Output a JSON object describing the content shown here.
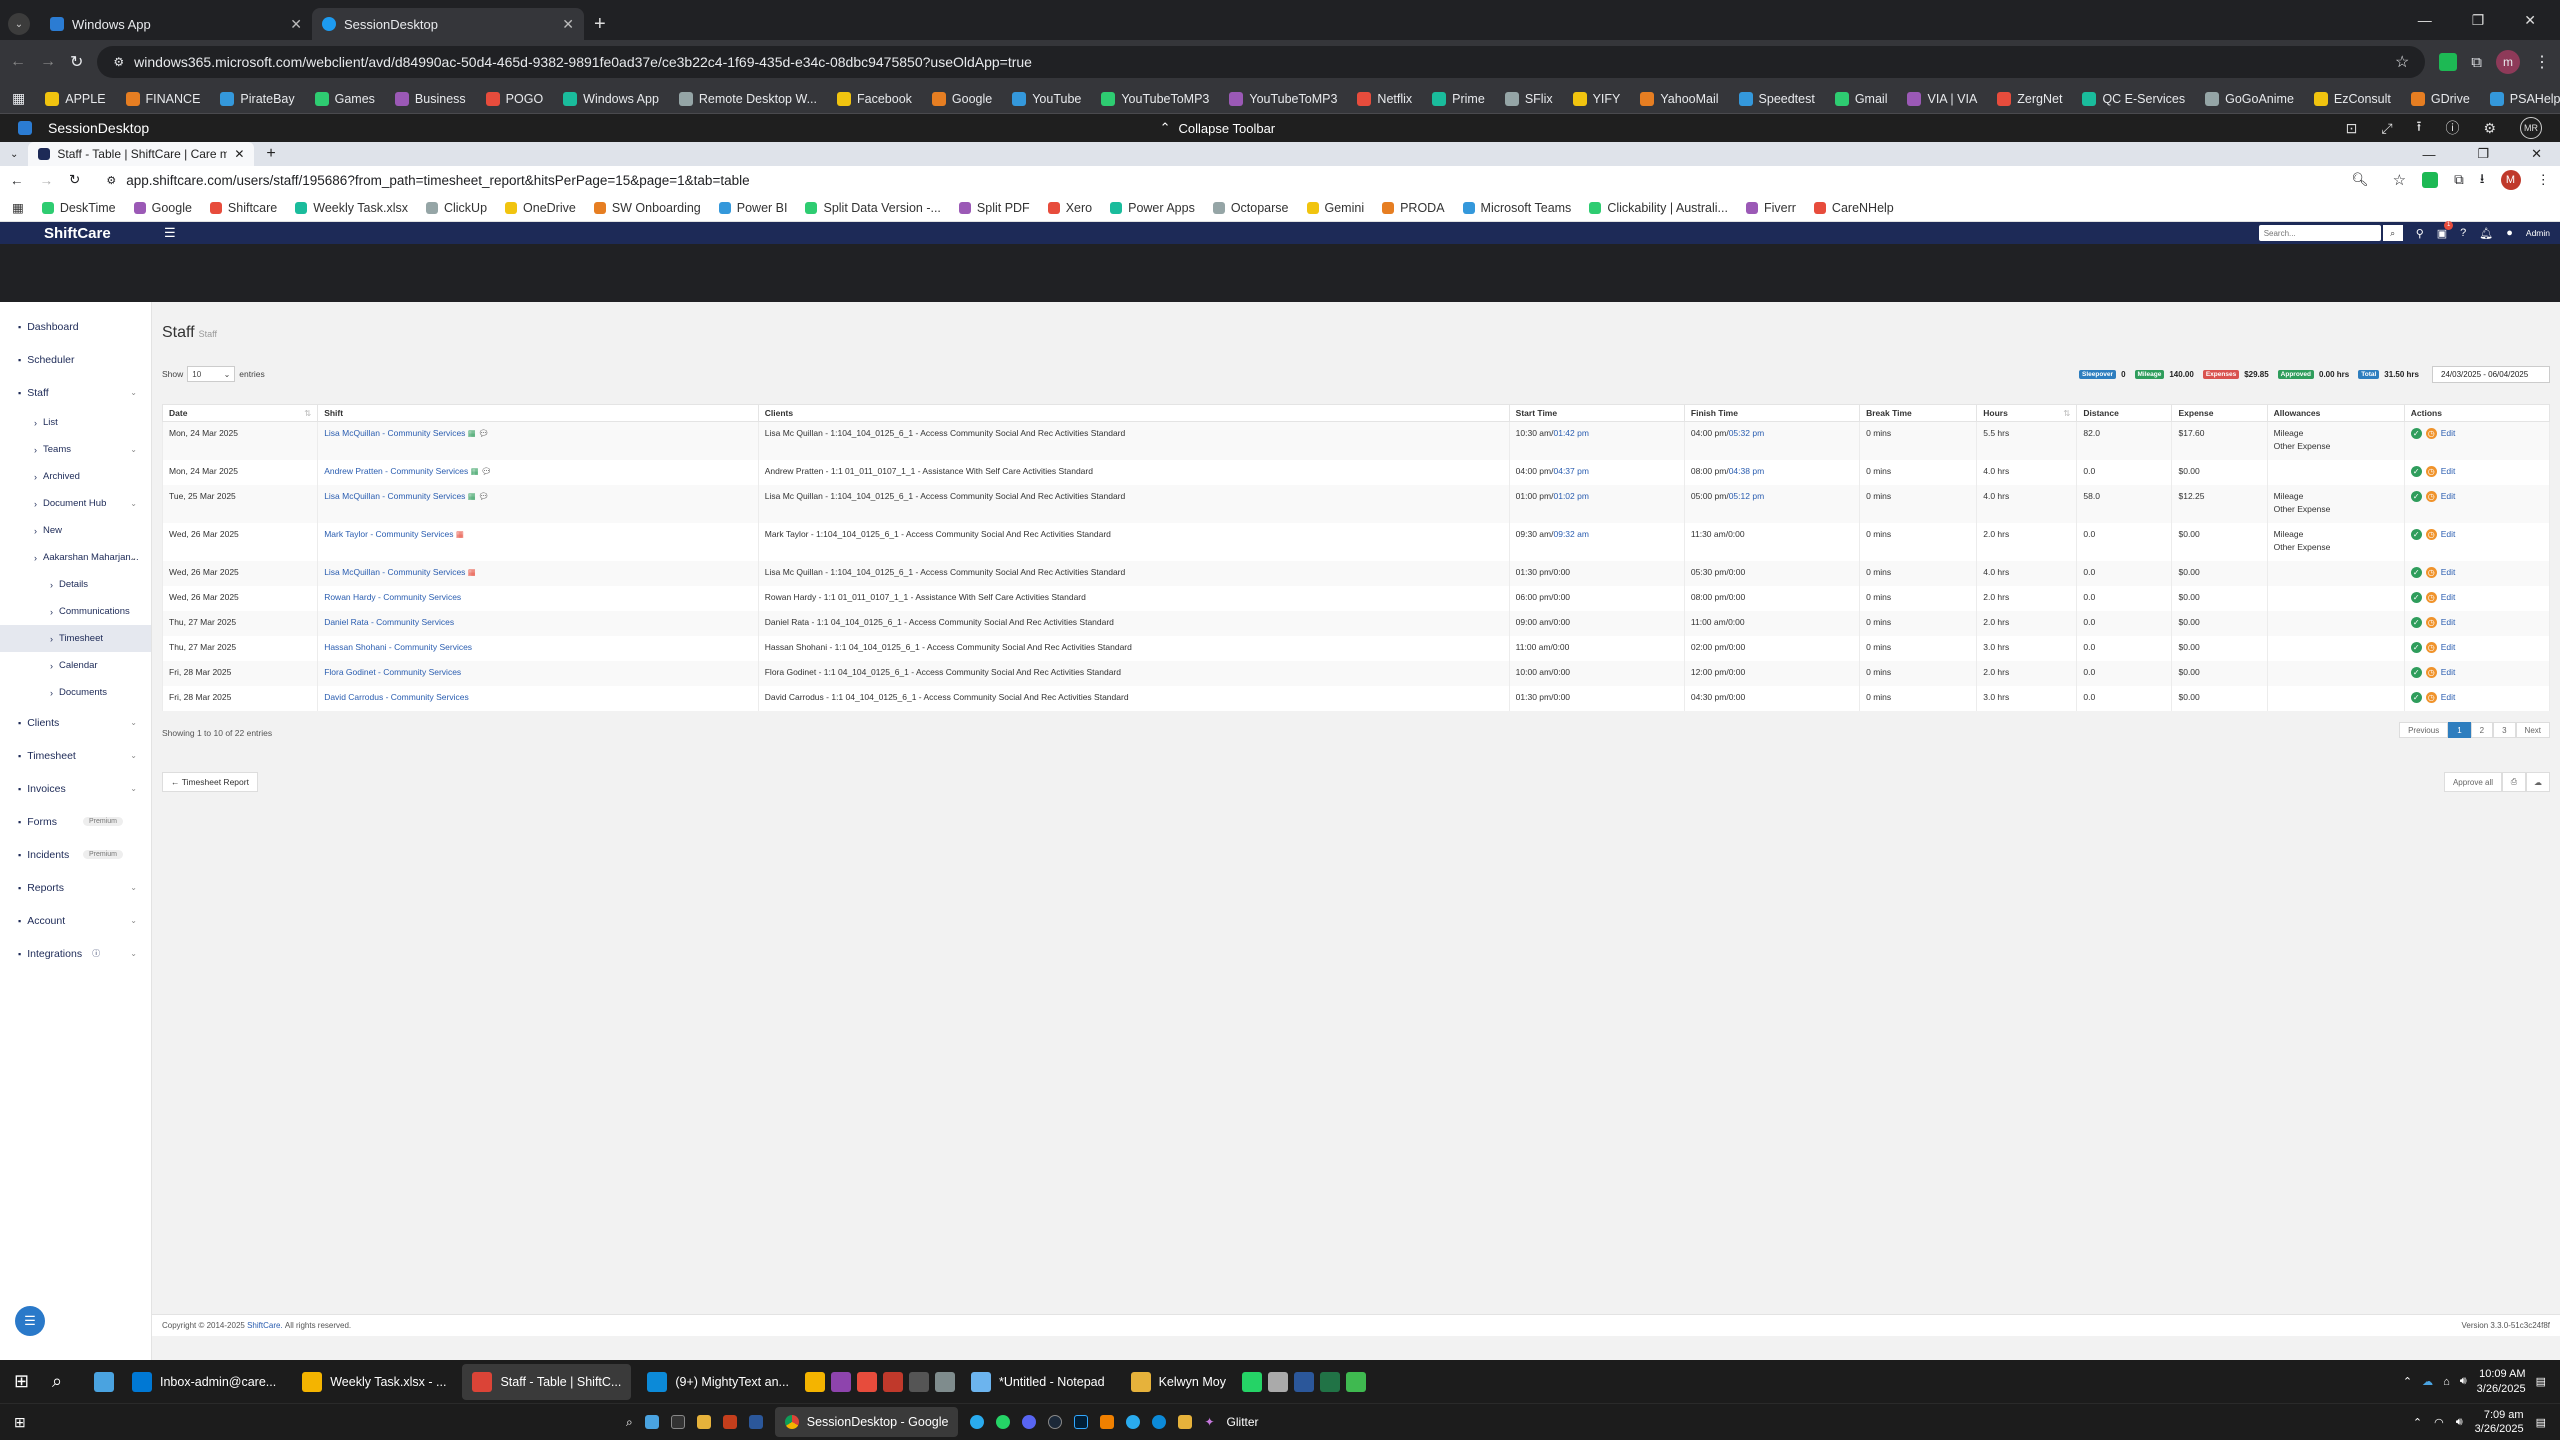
{
  "outer_browser": {
    "tabs": [
      {
        "title": "Windows App"
      },
      {
        "title": "SessionDesktop"
      }
    ],
    "url": "windows365.microsoft.com/webclient/avd/d84990ac-50d4-465d-9382-9891fe0ad37e/ce3b22c4-1f69-435d-e34c-08dbc9475850?useOldApp=true",
    "bookmarks": [
      "APPLE",
      "FINANCE",
      "PirateBay",
      "Games",
      "Business",
      "POGO",
      "Windows App",
      "Remote Desktop W...",
      "Facebook",
      "Google",
      "YouTube",
      "YouTubeToMP3",
      "YouTubeToMP3",
      "Netflix",
      "Prime",
      "SFlix",
      "YIFY",
      "YahooMail",
      "Speedtest",
      "Gmail",
      "VIA | VIA",
      "ZergNet",
      "QC E-Services",
      "GoGoAnime",
      "EzConsult",
      "GDrive",
      "PSAHelpLine"
    ],
    "profile": "m"
  },
  "session": {
    "title": "SessionDesktop",
    "collapse_label": "Collapse Toolbar",
    "avatar": "MR"
  },
  "inner_browser": {
    "tab_title": "Staff - Table | ShiftCare | Care m",
    "url": "app.shiftcare.com/users/staff/195686?from_path=timesheet_report&hitsPerPage=15&page=1&tab=table",
    "profile": "M",
    "bookmarks": [
      "DeskTime",
      "Google",
      "Shiftcare",
      "Weekly Task.xlsx",
      "ClickUp",
      "OneDrive",
      "SW Onboarding",
      "Power BI",
      "Split Data Version -...",
      "Split PDF",
      "Xero",
      "Power Apps",
      "Octoparse",
      "Gemini",
      "PRODA",
      "Microsoft Teams",
      "Clickability | Australi...",
      "Fiverr",
      "CareNHelp"
    ]
  },
  "shiftcare": {
    "brand": "ShiftCare",
    "search_placeholder": "Search...",
    "notif_count": "1",
    "admin_label": "Admin",
    "sidebar": [
      {
        "label": "Dashboard",
        "level": 0,
        "icon": "dashboard-icon"
      },
      {
        "label": "Scheduler",
        "level": 0,
        "icon": "calendar-icon"
      },
      {
        "label": "Staff",
        "level": 0,
        "icon": "user-icon",
        "caret": true
      },
      {
        "label": "List",
        "level": 1
      },
      {
        "label": "Teams",
        "level": 1,
        "caret": true
      },
      {
        "label": "Archived",
        "level": 1
      },
      {
        "label": "Document Hub",
        "level": 1,
        "caret": true
      },
      {
        "label": "New",
        "level": 1
      },
      {
        "label": "Aakarshan Maharjan...",
        "level": 1,
        "caret": true
      },
      {
        "label": "Details",
        "level": 2
      },
      {
        "label": "Communications",
        "level": 2
      },
      {
        "label": "Timesheet",
        "level": 2,
        "selected": true
      },
      {
        "label": "Calendar",
        "level": 2
      },
      {
        "label": "Documents",
        "level": 2
      },
      {
        "label": "Clients",
        "level": 0,
        "icon": "clients-icon",
        "caret": true
      },
      {
        "label": "Timesheet",
        "level": 0,
        "icon": "clock-icon",
        "caret": true
      },
      {
        "label": "Invoices",
        "level": 0,
        "icon": "invoice-icon",
        "caret": true
      },
      {
        "label": "Forms",
        "level": 0,
        "icon": "forms-icon",
        "badge": "Premium"
      },
      {
        "label": "Incidents",
        "level": 0,
        "icon": "incident-icon",
        "badge": "Premium"
      },
      {
        "label": "Reports",
        "level": 0,
        "icon": "reports-icon",
        "caret": true
      },
      {
        "label": "Account",
        "level": 0,
        "icon": "account-icon",
        "caret": true
      },
      {
        "label": "Integrations",
        "level": 0,
        "icon": "plug-icon",
        "caret": true,
        "info": true
      }
    ],
    "page_title": "Staff",
    "page_subtitle": "Staff",
    "show_label": "Show",
    "show_value": "10",
    "entries_label": "entries",
    "summary": [
      {
        "label": "Sleepover",
        "value": "0",
        "color": "#2e7ebf"
      },
      {
        "label": "Mileage",
        "value": "140.00",
        "color": "#2f9d5c"
      },
      {
        "label": "Expenses",
        "value": "$29.85",
        "color": "#d9534f"
      },
      {
        "label": "Approved",
        "value": "0.00 hrs",
        "color": "#2f9d5c"
      },
      {
        "label": "Total",
        "value": "31.50 hrs",
        "color": "#2e7ebf"
      }
    ],
    "date_range": "24/03/2025 - 06/04/2025",
    "columns": [
      "Date",
      "Shift",
      "Clients",
      "Start Time",
      "Finish Time",
      "Break Time",
      "Hours",
      "Distance",
      "Expense",
      "Allowances",
      "Actions"
    ],
    "rows": [
      {
        "date": "Mon, 24 Mar 2025",
        "shift": "Lisa McQuillan - Community Services",
        "flag": "green",
        "chat": true,
        "client": "Lisa Mc Quillan - 1:104_104_0125_6_1 - Access Community Social And Rec Activities Standard",
        "start": "10:30 am/",
        "start2": "01:42 pm",
        "finish": "04:00 pm/",
        "finish2": "05:32 pm",
        "break": "0 mins",
        "hours": "5.5 hrs",
        "distance": "82.0",
        "expense": "$17.60",
        "allowances": [
          "Mileage",
          "Other Expense"
        ]
      },
      {
        "date": "Mon, 24 Mar 2025",
        "shift": "Andrew Pratten - Community Services",
        "flag": "green",
        "chat": true,
        "client": "Andrew Pratten - 1:1 01_011_0107_1_1 - Assistance With Self Care Activities Standard",
        "start": "04:00 pm/",
        "start2": "04:37 pm",
        "finish": "08:00 pm/",
        "finish2": "04:38 pm",
        "break": "0 mins",
        "hours": "4.0 hrs",
        "distance": "0.0",
        "expense": "$0.00",
        "allowances": []
      },
      {
        "date": "Tue, 25 Mar 2025",
        "shift": "Lisa McQuillan - Community Services",
        "flag": "green",
        "chat": true,
        "client": "Lisa Mc Quillan - 1:104_104_0125_6_1 - Access Community Social And Rec Activities Standard",
        "start": "01:00 pm/",
        "start2": "01:02 pm",
        "finish": "05:00 pm/",
        "finish2": "05:12 pm",
        "break": "0 mins",
        "hours": "4.0 hrs",
        "distance": "58.0",
        "expense": "$12.25",
        "allowances": [
          "Mileage",
          "Other Expense"
        ]
      },
      {
        "date": "Wed, 26 Mar 2025",
        "shift": "Mark Taylor - Community Services",
        "flag": "red",
        "chat": false,
        "client": "Mark Taylor - 1:104_104_0125_6_1 - Access Community Social And Rec Activities Standard",
        "start": "09:30 am/",
        "start2": "09:32 am",
        "finish": "11:30 am/",
        "finish2": "0:00",
        "break": "0 mins",
        "hours": "2.0 hrs",
        "distance": "0.0",
        "expense": "$0.00",
        "allowances": [
          "Mileage",
          "Other Expense"
        ]
      },
      {
        "date": "Wed, 26 Mar 2025",
        "shift": "Lisa McQuillan - Community Services",
        "flag": "red",
        "chat": false,
        "client": "Lisa Mc Quillan - 1:104_104_0125_6_1 - Access Community Social And Rec Activities Standard",
        "start": "01:30 pm/",
        "start2": "0:00",
        "finish": "05:30 pm/",
        "finish2": "0:00",
        "break": "0 mins",
        "hours": "4.0 hrs",
        "distance": "0.0",
        "expense": "$0.00",
        "allowances": []
      },
      {
        "date": "Wed, 26 Mar 2025",
        "shift": "Rowan Hardy - Community Services",
        "flag": "",
        "chat": false,
        "client": "Rowan Hardy - 1:1 01_011_0107_1_1 - Assistance With Self Care Activities Standard",
        "start": "06:00 pm/",
        "start2": "0:00",
        "finish": "08:00 pm/",
        "finish2": "0:00",
        "break": "0 mins",
        "hours": "2.0 hrs",
        "distance": "0.0",
        "expense": "$0.00",
        "allowances": []
      },
      {
        "date": "Thu, 27 Mar 2025",
        "shift": "Daniel Rata - Community Services",
        "flag": "",
        "chat": false,
        "client": "Daniel Rata - 1:1 04_104_0125_6_1 - Access Community Social And Rec Activities Standard",
        "start": "09:00 am/",
        "start2": "0:00",
        "finish": "11:00 am/",
        "finish2": "0:00",
        "break": "0 mins",
        "hours": "2.0 hrs",
        "distance": "0.0",
        "expense": "$0.00",
        "allowances": []
      },
      {
        "date": "Thu, 27 Mar 2025",
        "shift": "Hassan Shohani - Community Services",
        "flag": "",
        "chat": false,
        "client": "Hassan Shohani - 1:1 04_104_0125_6_1 - Access Community Social And Rec Activities Standard",
        "start": "11:00 am/",
        "start2": "0:00",
        "finish": "02:00 pm/",
        "finish2": "0:00",
        "break": "0 mins",
        "hours": "3.0 hrs",
        "distance": "0.0",
        "expense": "$0.00",
        "allowances": []
      },
      {
        "date": "Fri, 28 Mar 2025",
        "shift": "Flora Godinet - Community Services",
        "flag": "",
        "chat": false,
        "client": "Flora Godinet - 1:1 04_104_0125_6_1 - Access Community Social And Rec Activities Standard",
        "start": "10:00 am/",
        "start2": "0:00",
        "finish": "12:00 pm/",
        "finish2": "0:00",
        "break": "0 mins",
        "hours": "2.0 hrs",
        "distance": "0.0",
        "expense": "$0.00",
        "allowances": []
      },
      {
        "date": "Fri, 28 Mar 2025",
        "shift": "David Carrodus - Community Services",
        "flag": "",
        "chat": false,
        "client": "David Carrodus - 1:1 04_104_0125_6_1 - Access Community Social And Rec Activities Standard",
        "start": "01:30 pm/",
        "start2": "0:00",
        "finish": "04:30 pm/",
        "finish2": "0:00",
        "break": "0 mins",
        "hours": "3.0 hrs",
        "distance": "0.0",
        "expense": "$0.00",
        "allowances": []
      }
    ],
    "edit_label": "Edit",
    "showing": "Showing 1 to 10 of 22 entries",
    "pagination": [
      "Previous",
      "1",
      "2",
      "3",
      "Next"
    ],
    "timesheet_report_btn": "← Timesheet Report",
    "approve_all": "Approve all",
    "copyright": "Copyright © 2014-2025",
    "copyright_link": "ShiftCare.",
    "rights": "All rights reserved.",
    "version": "Version 3.3.0-51c3c24f8f"
  },
  "taskbar_inner": {
    "apps": [
      "Inbox-admin@care...",
      "Weekly Task.xlsx - ...",
      "Staff - Table | ShiftC...",
      "(9+) MightyText an...",
      "*Untitled - Notepad",
      "Kelwyn Moy"
    ],
    "time": "10:09 AM",
    "date": "3/26/2025"
  },
  "taskbar_outer": {
    "active_app": "SessionDesktop - Google",
    "glitter": "Glitter",
    "time": "7:09 am",
    "date": "3/26/2025"
  }
}
